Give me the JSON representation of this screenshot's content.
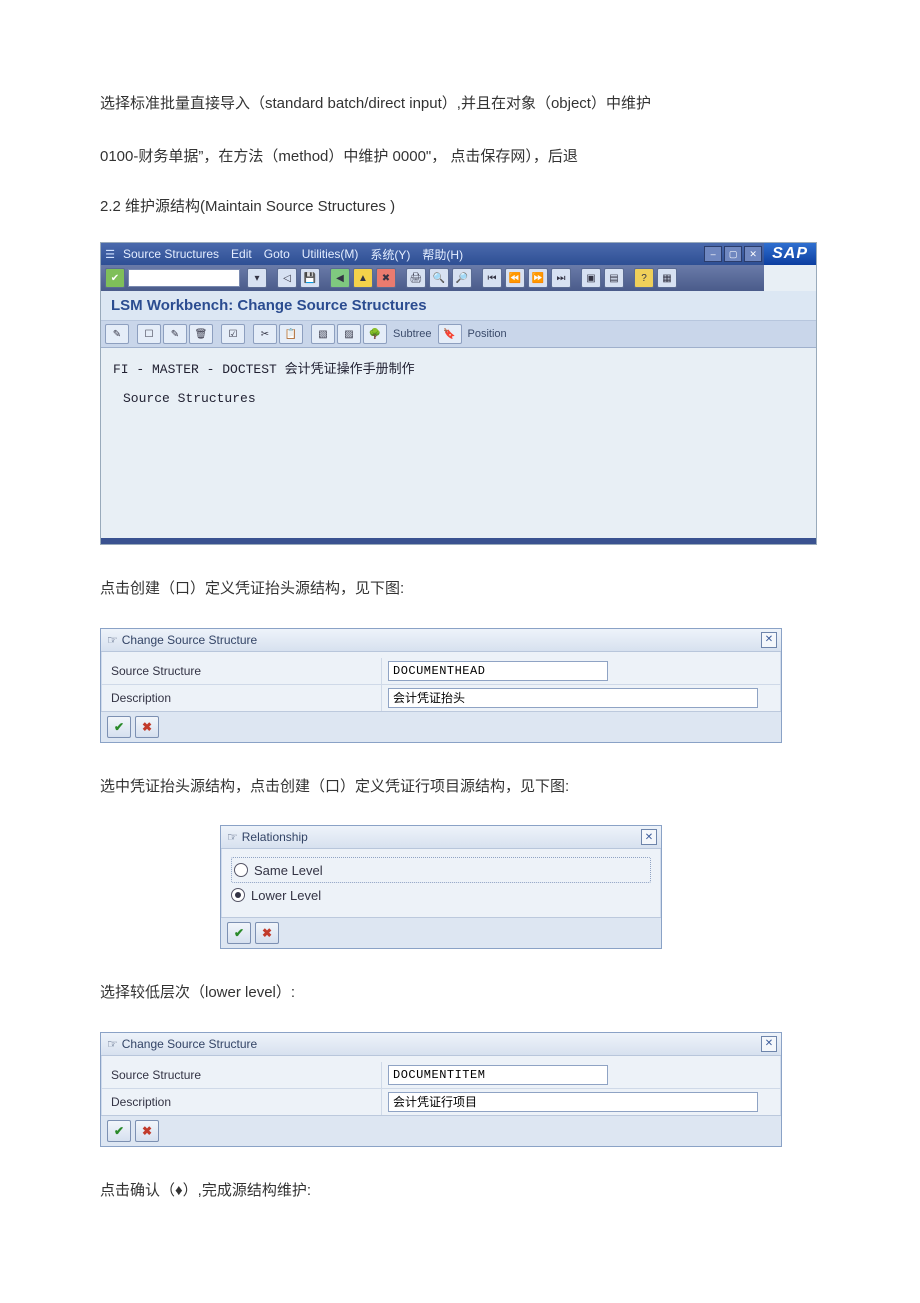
{
  "paragraphs": {
    "p1": "选择标准批量直接导入（standard batch/direct input）,并且在对象（object）中维护",
    "p2": " 0100-财务单据”，在方法（method）中维护 0000\"， 点击保存网），后退",
    "sec22": "2.2 维护源结构(Maintain Source Structures )",
    "p3": "点击创建（口）定义凭证抬头源结构，见下图:",
    "p4": "选中凭证抬头源结构，点击创建（口）定义凭证行项目源结构，见下图:",
    "p5": "选择较低层次（lower level）:",
    "p6": "点击确认（♦）,完成源结构维护:"
  },
  "sap_window": {
    "menus": {
      "m1": "Source Structures",
      "m2": "Edit",
      "m3": "Goto",
      "m4": "Utilities(M)",
      "m5": "系统(Y)",
      "m6": "帮助(H)"
    },
    "logo": "SAP",
    "subtitle": "LSM Workbench: Change Source Structures",
    "app_toolbar": {
      "subtree": "Subtree",
      "position": "Position"
    },
    "body_line1": "FI - MASTER - DOCTEST 会计凭证操作手册制作",
    "body_line2": "Source Structures"
  },
  "dialog_head": {
    "title": "Change Source Structure",
    "label_struct": "Source Structure",
    "val_struct": "DOCUMENTHEAD",
    "label_desc": "Description",
    "val_desc": "会计凭证抬头"
  },
  "dialog_rel": {
    "title": "Relationship",
    "opt_same": "Same Level",
    "opt_lower": "Lower Level"
  },
  "dialog_item": {
    "title": "Change Source Structure",
    "label_struct": "Source Structure",
    "val_struct": "DOCUMENTITEM",
    "label_desc": "Description",
    "val_desc": "会计凭证行项目"
  }
}
